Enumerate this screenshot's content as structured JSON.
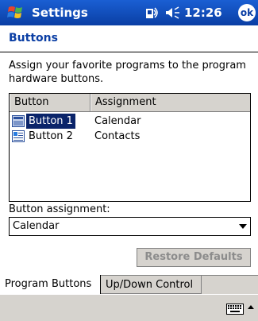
{
  "titlebar": {
    "title": "Settings",
    "time": "12:26",
    "ok_label": "ok"
  },
  "page": {
    "title": "Buttons",
    "description": "Assign your favorite programs to the program hardware buttons."
  },
  "listview": {
    "columns": [
      "Button",
      "Assignment"
    ],
    "rows": [
      {
        "button": "Button 1",
        "assignment": "Calendar",
        "selected": true
      },
      {
        "button": "Button 2",
        "assignment": "Contacts",
        "selected": false
      }
    ]
  },
  "assignment": {
    "label": "Button assignment:",
    "value": "Calendar"
  },
  "restore_label": "Restore Defaults",
  "tabs": [
    "Program Buttons",
    "Up/Down Control"
  ],
  "colors": {
    "titlebar": "#0a3ea4",
    "selection": "#0a246a",
    "heading": "#0a3ea4",
    "chrome": "#d6d3ce"
  }
}
